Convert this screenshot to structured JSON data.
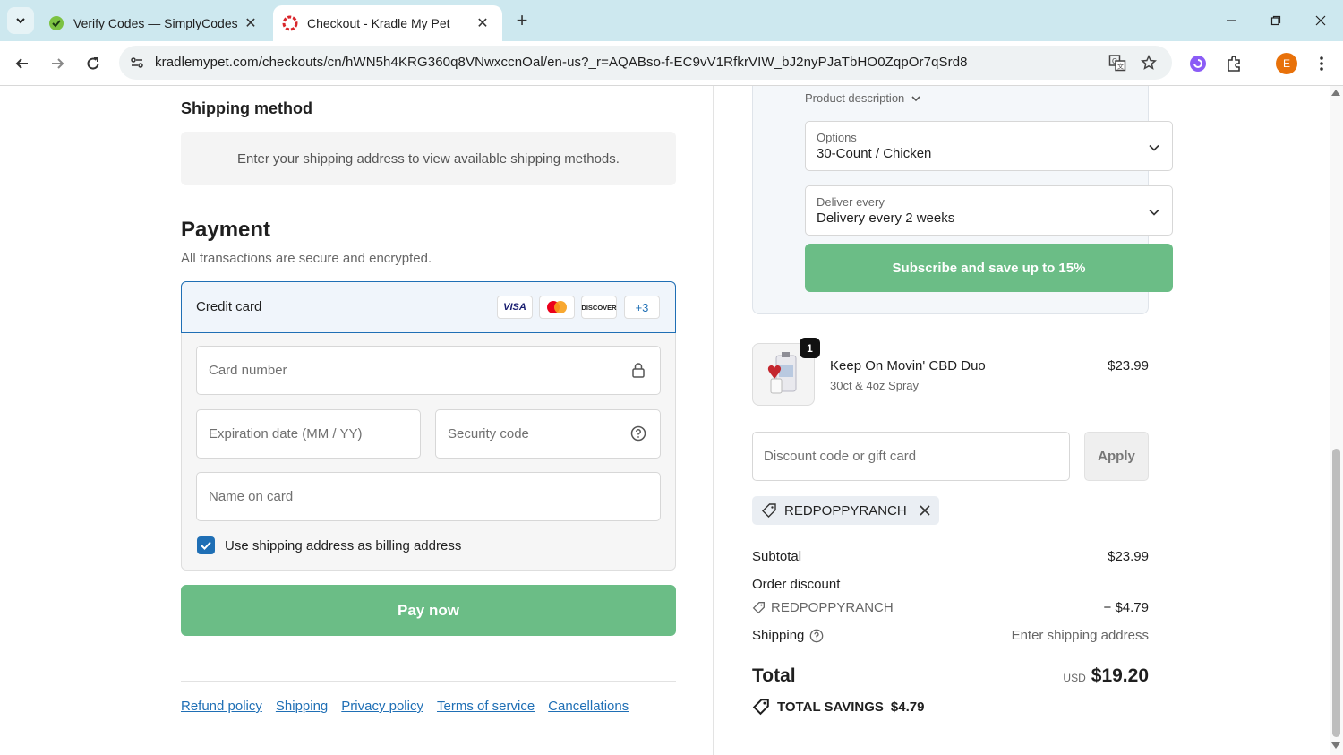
{
  "browser": {
    "tabs": [
      {
        "title": "Verify Codes — SimplyCodes",
        "active": false
      },
      {
        "title": "Checkout - Kradle My Pet",
        "active": true
      }
    ],
    "url": "kradlemypet.com/checkouts/cn/hWN5h4KRG360q8VNwxccnOal/en-us?_r=AQABso-f-EC9vV1RfkrVIW_bJ2nyPJaTbHO0ZqpOr7qSrd8",
    "profile_initial": "E"
  },
  "shipping": {
    "heading": "Shipping method",
    "message": "Enter your shipping address to view available shipping methods."
  },
  "payment": {
    "heading": "Payment",
    "subtitle": "All transactions are secure and encrypted.",
    "method_label": "Credit card",
    "card_brands": [
      "VISA",
      "",
      "DISCOVER"
    ],
    "more_cards": "+3",
    "card_number_placeholder": "Card number",
    "expiry_placeholder": "Expiration date (MM / YY)",
    "security_placeholder": "Security code",
    "name_placeholder": "Name on card",
    "billing_checkbox_label": "Use shipping address as billing address",
    "billing_checked": true,
    "pay_button": "Pay now"
  },
  "footer": {
    "links": [
      "Refund policy",
      "Shipping",
      "Privacy policy",
      "Terms of service",
      "Cancellations"
    ]
  },
  "subscription": {
    "product_description_label": "Product description",
    "options_label": "Options",
    "options_value": "30-Count / Chicken",
    "deliver_label": "Deliver every",
    "deliver_value": "Delivery every 2 weeks",
    "subscribe_button": "Subscribe and save up to 15%"
  },
  "cart": {
    "quantity": "1",
    "product_name": "Keep On Movin' CBD Duo",
    "variant": "30ct & 4oz Spray",
    "price": "$23.99"
  },
  "discount": {
    "placeholder": "Discount code or gift card",
    "apply_button": "Apply",
    "applied_code": "REDPOPPYRANCH"
  },
  "summary": {
    "subtotal_label": "Subtotal",
    "subtotal_value": "$23.99",
    "order_discount_label": "Order discount",
    "discount_code": "REDPOPPYRANCH",
    "discount_value": "− $4.79",
    "shipping_label": "Shipping",
    "shipping_value": "Enter shipping address",
    "total_label": "Total",
    "currency": "USD",
    "total_value": "$19.20",
    "savings_label": "TOTAL SAVINGS",
    "savings_value": "$4.79"
  },
  "colors": {
    "accent": "#1f6fb5",
    "button_green": "#6bbd86",
    "tabbar": "#cde8ef"
  }
}
